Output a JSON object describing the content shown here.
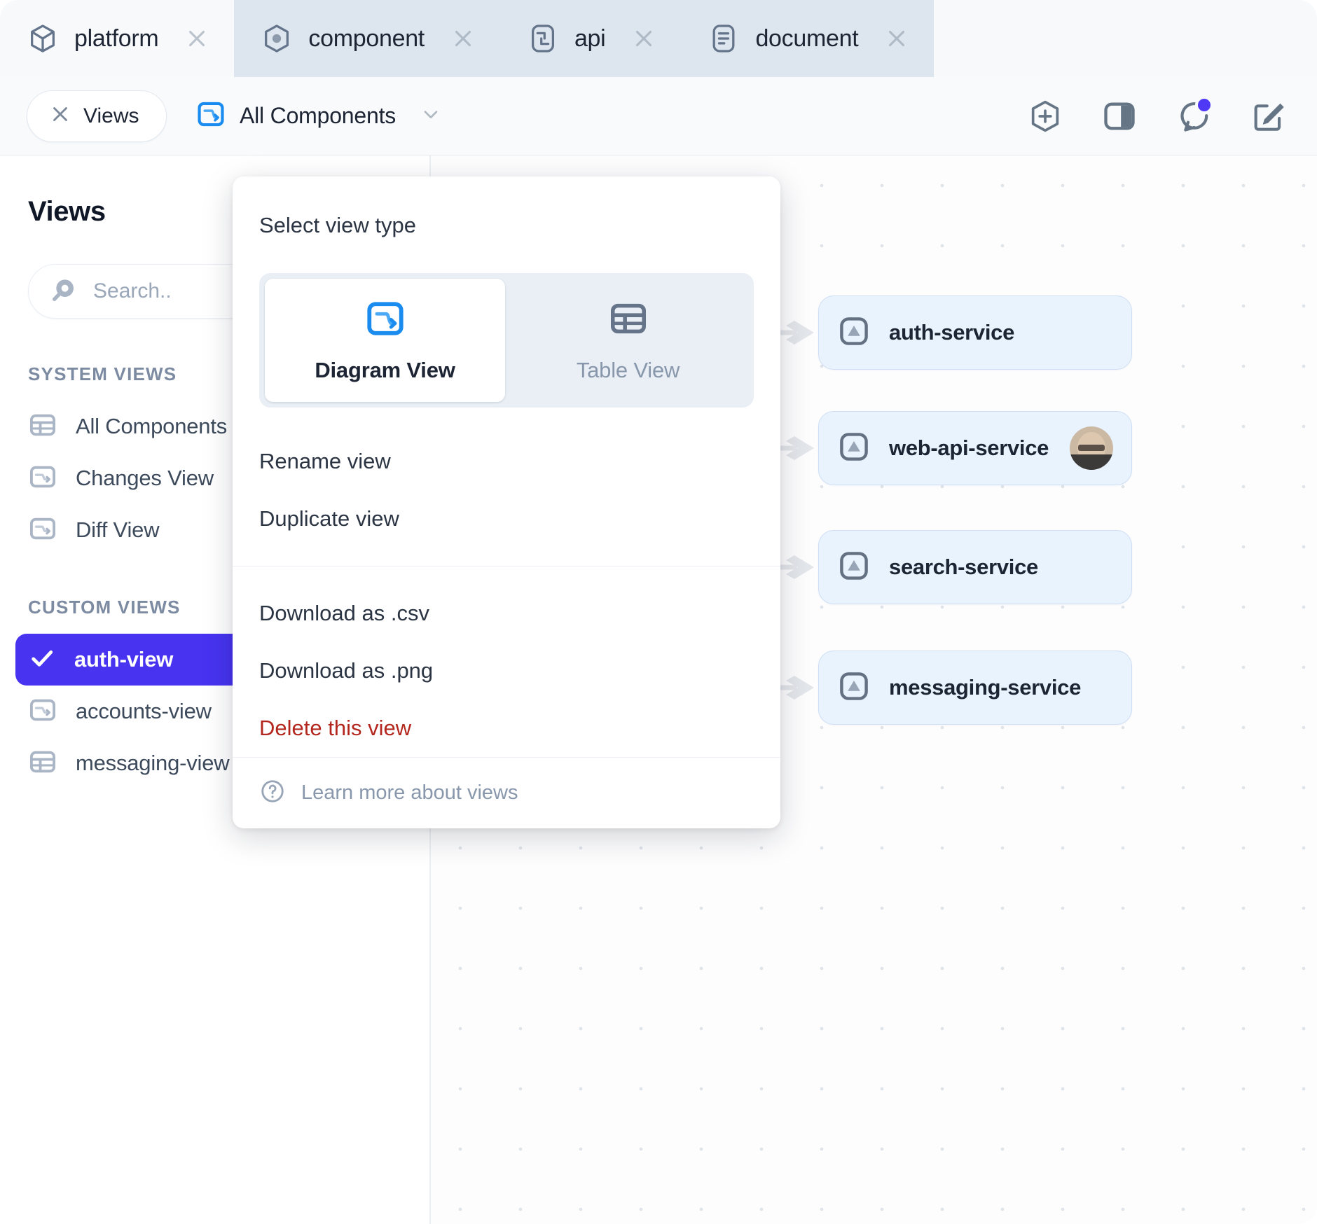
{
  "tabs": [
    {
      "label": "platform",
      "icon": "cube-icon",
      "active": false
    },
    {
      "label": "component",
      "icon": "target-icon",
      "active": true
    },
    {
      "label": "api",
      "icon": "api-icon",
      "active": false
    },
    {
      "label": "document",
      "icon": "document-icon",
      "active": false
    }
  ],
  "toolbar": {
    "views_label": "Views",
    "current_view": "All Components",
    "icons": [
      "add-hexagon-icon",
      "panel-toggle-icon",
      "comments-icon",
      "edit-note-icon"
    ],
    "notification_dot_color": "#4f39f6"
  },
  "sidebar": {
    "title": "Views",
    "search_placeholder": "Search..",
    "search_value": "",
    "groups": [
      {
        "label": "SYSTEM VIEWS",
        "items": [
          {
            "label": "All Components",
            "icon": "table-icon",
            "selected": false,
            "menu": false
          },
          {
            "label": "Changes View",
            "icon": "diagram-icon",
            "selected": false,
            "menu": false
          },
          {
            "label": "Diff View",
            "icon": "diagram-icon",
            "selected": false,
            "menu": false
          }
        ]
      },
      {
        "label": "CUSTOM VIEWS",
        "items": [
          {
            "label": "auth-view",
            "icon": "check-icon",
            "selected": true,
            "menu": false
          },
          {
            "label": "accounts-view",
            "icon": "diagram-icon",
            "selected": false,
            "menu": true
          },
          {
            "label": "messaging-view",
            "icon": "table-icon",
            "selected": false,
            "menu": true
          }
        ]
      }
    ]
  },
  "menu": {
    "title": "Select view type",
    "options": [
      {
        "label": "Diagram View",
        "icon": "diagram-icon",
        "selected": true
      },
      {
        "label": "Table View",
        "icon": "table-icon",
        "selected": false
      }
    ],
    "items": [
      {
        "label": "Rename view",
        "danger": false
      },
      {
        "label": "Duplicate view",
        "danger": false
      },
      {
        "label": "Download as .csv",
        "danger": false
      },
      {
        "label": "Download as .png",
        "danger": false
      },
      {
        "label": "Delete this view",
        "danger": true
      }
    ],
    "footer": {
      "label": "Learn more about views",
      "icon": "help-circle-icon"
    }
  },
  "canvas": {
    "nodes": [
      {
        "label": "auth-service",
        "icon": "component-triangle-icon",
        "avatar": false
      },
      {
        "label": "web-api-service",
        "icon": "component-triangle-icon",
        "avatar": true
      },
      {
        "label": "search-service",
        "icon": "component-triangle-icon",
        "avatar": false
      },
      {
        "label": "messaging-service",
        "icon": "component-triangle-icon",
        "avatar": false
      }
    ],
    "root_node_color": "#2a3344",
    "node_fill": "#e8f3fd",
    "node_border": "#cfdef5"
  }
}
